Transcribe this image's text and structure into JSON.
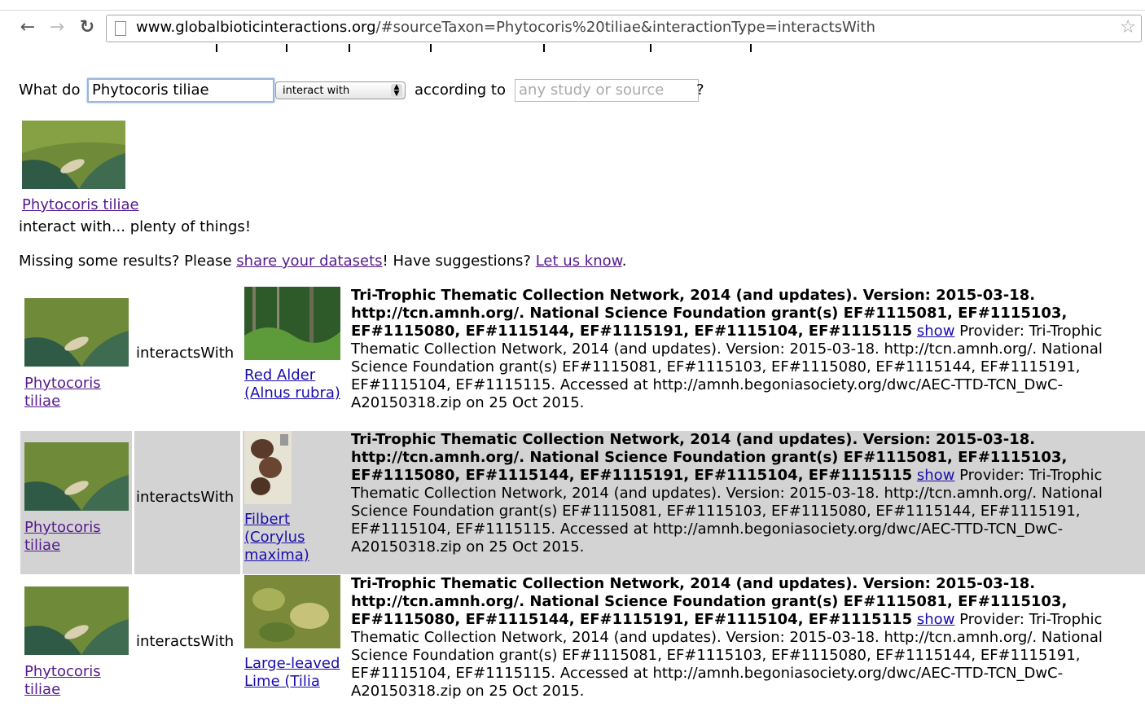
{
  "browser": {
    "url_host": "www.globalbioticinteractions.org",
    "url_rest": "/#sourceTaxon=Phytocoris%20tiliae&interactionType=interactsWith"
  },
  "query": {
    "label_what": "What do",
    "source_value": "Phytocoris tiliae",
    "interaction_type": "interact with",
    "label_according": "according to",
    "study_placeholder": "any study or source",
    "question_mark": "?"
  },
  "summary": {
    "taxon_link": "Phytocoris tiliae",
    "interact_text": "interact with... plenty of things!"
  },
  "missing": {
    "prefix": "Missing some results? Please ",
    "share_link": "share your datasets",
    "middle": "! Have suggestions? ",
    "let_link": "Let us know",
    "suffix": "."
  },
  "results": [
    {
      "source": "Phytocoris tiliae",
      "interaction": "interactsWith",
      "target": "Red Alder (Alnus rubra)",
      "citation_bold": "Tri-Trophic Thematic Collection Network, 2014 (and updates). Version: 2015-03-18. http://tcn.amnh.org/. National Science Foundation grant(s) EF#1115081, EF#1115103, EF#1115080, EF#1115144, EF#1115191, EF#1115104, EF#1115115",
      "show": "show",
      "provider": " Provider: Tri-Trophic Thematic Collection Network, 2014 (and updates). Version: 2015-03-18. http://tcn.amnh.org/. National Science Foundation grant(s) EF#1115081, EF#1115103, EF#1115080, EF#1115144, EF#1115191, EF#1115104, EF#1115115. Accessed at http://amnh.begoniasociety.org/dwc/AEC-TTD-TCN_DwC-A20150318.zip on 25 Oct 2015."
    },
    {
      "source": "Phytocoris tiliae",
      "interaction": "interactsWith",
      "target": "Filbert (Corylus maxima)",
      "citation_bold": "Tri-Trophic Thematic Collection Network, 2014 (and updates). Version: 2015-03-18. http://tcn.amnh.org/. National Science Foundation grant(s) EF#1115081, EF#1115103, EF#1115080, EF#1115144, EF#1115191, EF#1115104, EF#1115115",
      "show": "show",
      "provider": " Provider: Tri-Trophic Thematic Collection Network, 2014 (and updates). Version: 2015-03-18. http://tcn.amnh.org/. National Science Foundation grant(s) EF#1115081, EF#1115103, EF#1115080, EF#1115144, EF#1115191, EF#1115104, EF#1115115. Accessed at http://amnh.begoniasociety.org/dwc/AEC-TTD-TCN_DwC-A20150318.zip on 25 Oct 2015."
    },
    {
      "source": "Phytocoris tiliae",
      "interaction": "interactsWith",
      "target": "Large-leaved Lime (Tilia",
      "citation_bold": "Tri-Trophic Thematic Collection Network, 2014 (and updates). Version: 2015-03-18. http://tcn.amnh.org/. National Science Foundation grant(s) EF#1115081, EF#1115103, EF#1115080, EF#1115144, EF#1115191, EF#1115104, EF#1115115",
      "show": "show",
      "provider": " Provider: Tri-Trophic Thematic Collection Network, 2014 (and updates). Version: 2015-03-18. http://tcn.amnh.org/. National Science Foundation grant(s) EF#1115081, EF#1115103, EF#1115080, EF#1115144, EF#1115191, EF#1115104, EF#1115115. Accessed at http://amnh.begoniasociety.org/dwc/AEC-TTD-TCN_DwC-A20150318.zip on 25 Oct 2015."
    }
  ]
}
